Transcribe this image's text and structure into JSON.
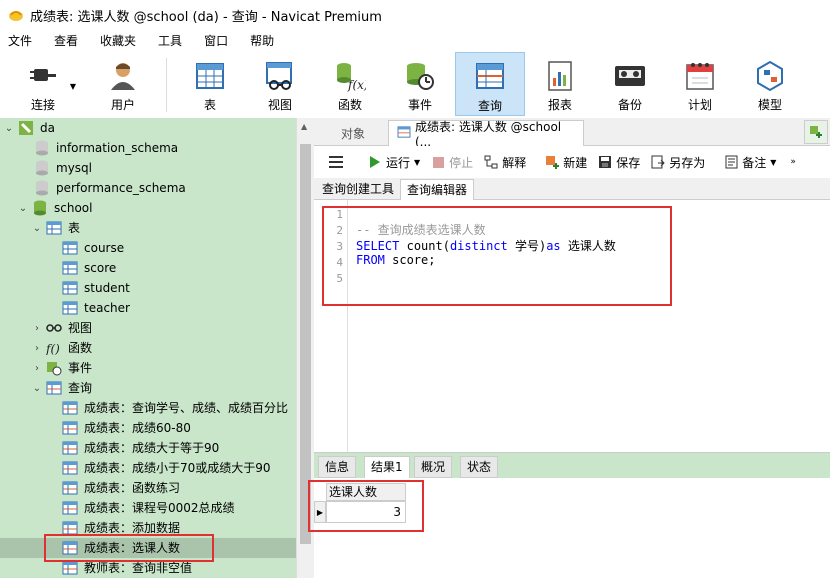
{
  "window": {
    "title": "成绩表: 选课人数 @school (da) - 查询 - Navicat Premium"
  },
  "menu": [
    "文件",
    "查看",
    "收藏夹",
    "工具",
    "窗口",
    "帮助"
  ],
  "toolbar": {
    "connect": "连接",
    "user": "用户",
    "table": "表",
    "view": "视图",
    "function": "函数",
    "event": "事件",
    "query": "查询",
    "report": "报表",
    "backup": "备份",
    "schedule": "计划",
    "model": "模型"
  },
  "tree": {
    "connection": "da",
    "databases": [
      "information_schema",
      "mysql",
      "performance_schema",
      "school"
    ],
    "tables_label": "表",
    "tables": [
      "course",
      "score",
      "student",
      "teacher"
    ],
    "views_label": "视图",
    "functions_label": "函数",
    "events_label": "事件",
    "queries_label": "查询",
    "queries": [
      "成绩表：查询学号、成绩、成绩百分比",
      "成绩表：成绩60-80",
      "成绩表：成绩大于等于90",
      "成绩表：成绩小于70或成绩大于90",
      "成绩表：函数练习",
      "成绩表：课程号0002总成绩",
      "成绩表：添加数据",
      "成绩表：选课人数",
      "教师表：查询非空值"
    ]
  },
  "tabs": {
    "objects": "对象",
    "query_tab": "成绩表: 选课人数 @school (..."
  },
  "query_toolbar": {
    "run": "运行",
    "stop": "停止",
    "explain": "解释",
    "new": "新建",
    "save": "保存",
    "save_as": "另存为",
    "notes": "备注"
  },
  "subtabs": {
    "builder": "查询创建工具",
    "editor": "查询编辑器"
  },
  "editor": {
    "line_numbers": [
      "1",
      "2",
      "3",
      "4",
      "5"
    ],
    "line2": "-- 查询成绩表选课人数",
    "line3_select": "SELECT",
    "line3_count": "count(",
    "line3_distinct": "distinct",
    "line3_col": " 学号)",
    "line3_as": "as",
    "line3_alias": " 选课人数",
    "line4_from": "FROM",
    "line4_rest": " score;"
  },
  "result_tabs": [
    "信息",
    "结果1",
    "概况",
    "状态"
  ],
  "result": {
    "column": "选课人数",
    "value": "3"
  },
  "colors": {
    "tree_bg": "#c9e6cb",
    "highlight": "#e03030",
    "keyword": "#0000ff",
    "active_tool": "#cce4f7"
  }
}
